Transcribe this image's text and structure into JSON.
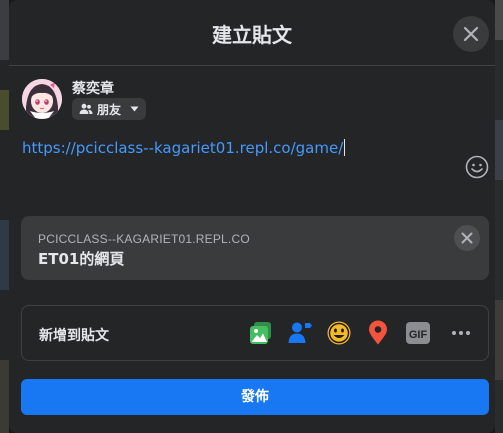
{
  "dialog": {
    "title": "建立貼文",
    "close_icon": "close-icon"
  },
  "author": {
    "name": "蔡奕章",
    "privacy_label": "朋友",
    "privacy_icon": "friends-icon"
  },
  "composer": {
    "text": "https://pcicclass--kagariet01.repl.co/game/",
    "emoji_icon": "smiley-icon"
  },
  "link_preview": {
    "domain": "PCICCLASS--KAGARIET01.REPL.CO",
    "title": "ET01的網頁",
    "remove_icon": "close-icon"
  },
  "add_to_post": {
    "label": "新增到貼文",
    "icons": [
      "photo-video-icon",
      "tag-people-icon",
      "feeling-icon",
      "check-in-icon",
      "gif-icon",
      "more-icon"
    ],
    "gif_text": "GIF"
  },
  "publish_label": "發佈",
  "colors": {
    "accent": "#1877f2",
    "link": "#4599ff",
    "dialog_bg": "#242526",
    "photo_green": "#45bd62",
    "tag_blue": "#1877f2",
    "feeling_yellow": "#f7b928",
    "location_red": "#f5533d"
  }
}
